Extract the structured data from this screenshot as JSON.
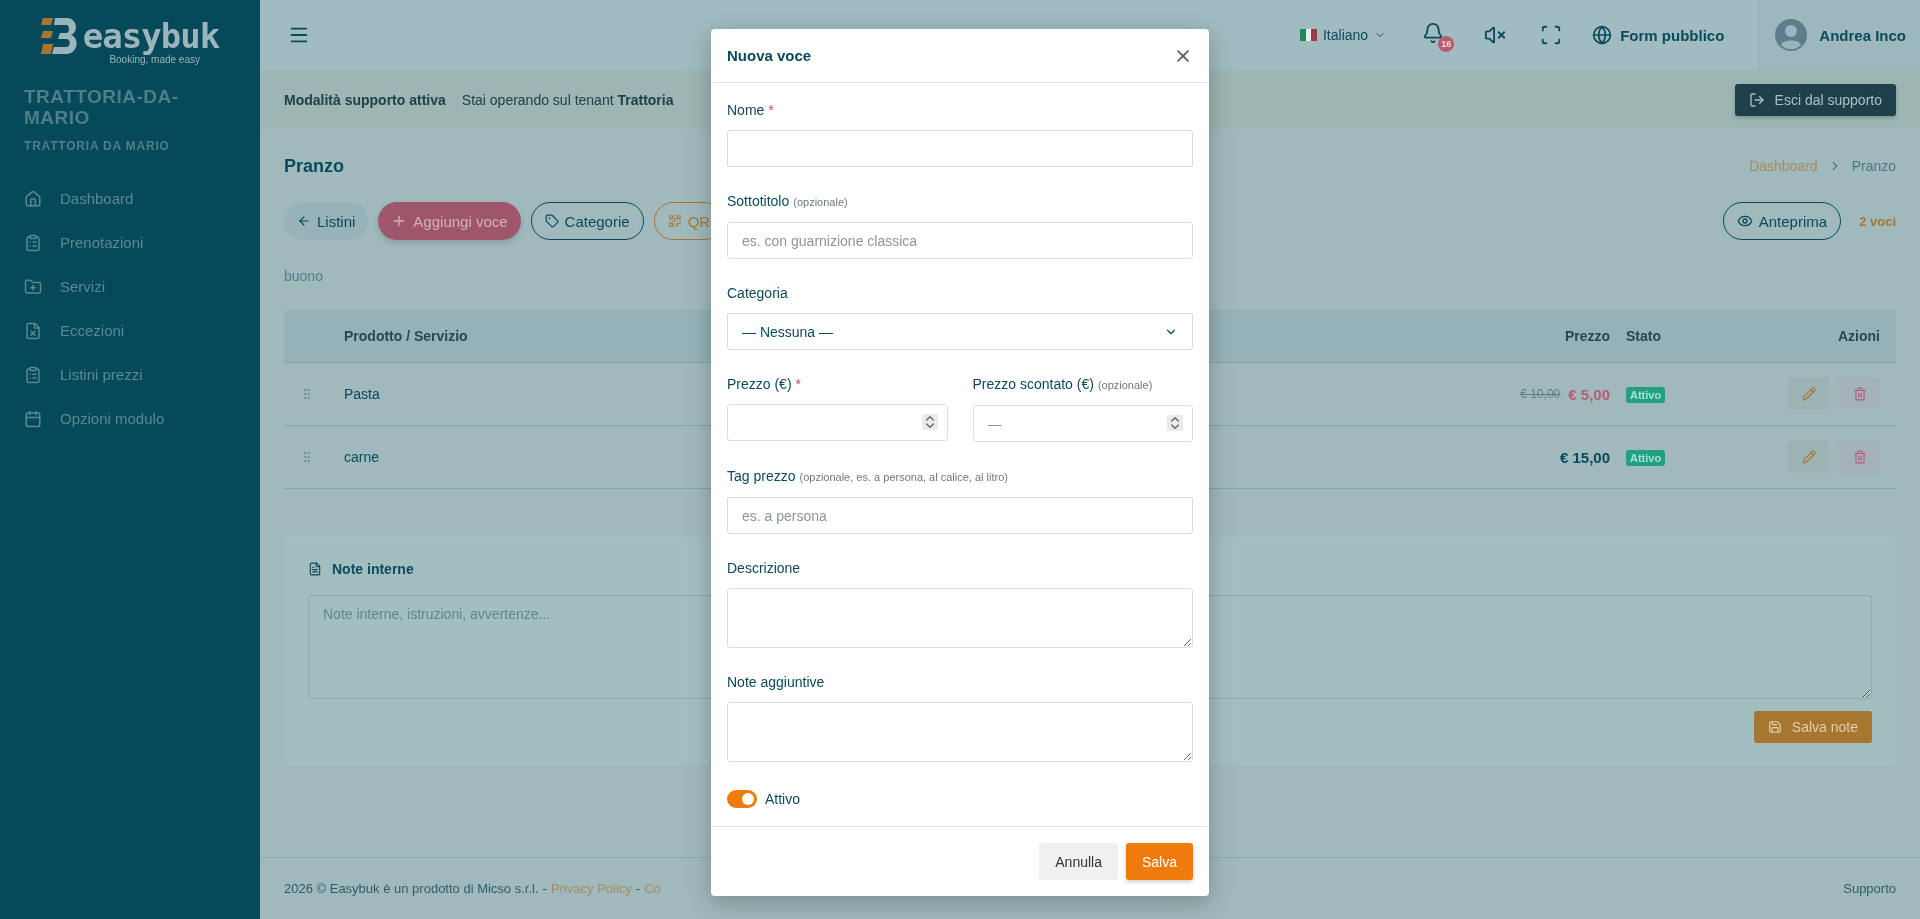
{
  "sidebar": {
    "logo": {
      "name": "easybuk",
      "tagline": "Booking, made easy"
    },
    "tenant_slug": "TRATTORIA-DA-MARIO",
    "tenant_name": "TRATTORIA DA MARIO",
    "items": [
      {
        "label": "Dashboard",
        "selected": false
      },
      {
        "label": "Prenotazioni",
        "selected": false
      },
      {
        "label": "Servizi",
        "selected": false
      },
      {
        "label": "Eccezioni",
        "selected": false
      },
      {
        "label": "Listini prezzi",
        "selected": false
      },
      {
        "label": "Opzioni modulo",
        "selected": false
      }
    ]
  },
  "topbar": {
    "language": "Italiano",
    "notifications": "16",
    "public_form": "Form pubblico",
    "user": "Andrea Inco"
  },
  "support_banner": {
    "title": "Modalità supporto attiva",
    "message": "Stai operando sul tenant **Trattoria**",
    "button": "Esci dal supporto"
  },
  "page": {
    "title": "Pranzo",
    "breadcrumb": [
      {
        "label": "Dashboard",
        "kind": "link"
      },
      {
        "label": "Pranzo",
        "kind": "current"
      }
    ],
    "toolbar": [
      {
        "label": "Listini",
        "kind": "back"
      },
      {
        "label": "Aggiungi voce",
        "kind": "primary"
      },
      {
        "label": "Categorie",
        "kind": "outline"
      },
      {
        "label": "QR",
        "kind": "warning"
      }
    ],
    "preview_button": "Anteprima",
    "count": "2 voci",
    "description": "buono"
  },
  "table": {
    "columns": [
      "Prodotto / Servizio",
      "Prezzo",
      "Stato",
      "Azioni"
    ],
    "rows": [
      {
        "name": "Pasta",
        "old_price": "€ 10,00",
        "price": "€ 5,00",
        "status": "Attivo"
      },
      {
        "name": "carne",
        "price": "€ 15,00",
        "status": "Attivo"
      }
    ]
  },
  "notes": {
    "title": "Note interne",
    "placeholder": "Note interne, istruzioni, avvertenze...",
    "button": "Salva note"
  },
  "footer": {
    "text": "2026 © Easybuk è un prodotto di Micso s.r.l.",
    "separator": "-",
    "links": [
      "Privacy Policy",
      "Co"
    ],
    "support": "Supporto"
  },
  "modal": {
    "title": "Nuova voce",
    "fields": [
      {
        "kind": "text",
        "label": "Nome",
        "required_mark": "*"
      },
      {
        "kind": "text",
        "label": "Sottotitolo",
        "hint": "(opzionale)",
        "placeholder": "es. con guarnizione classica"
      },
      {
        "kind": "select",
        "label": "Categoria",
        "value": "— Nessuna —"
      },
      {
        "kind": "number",
        "label": "Prezzo (€)",
        "required_mark": "*"
      },
      {
        "kind": "number",
        "label": "Prezzo scontato (€)",
        "hint": "(opzionale)",
        "placeholder": "—"
      },
      {
        "kind": "text",
        "label": "Tag prezzo",
        "hint": "(opzionale, es. a persona, al calice, al litro)",
        "placeholder": "es. a persona"
      },
      {
        "kind": "textarea",
        "label": "Descrizione"
      },
      {
        "kind": "textarea",
        "label": "Note aggiuntive"
      }
    ],
    "active": {
      "label": "Attivo",
      "on": true
    },
    "buttons": [
      {
        "label": "Annulla",
        "kind": "secondary"
      },
      {
        "label": "Salva",
        "kind": "primary"
      }
    ]
  }
}
